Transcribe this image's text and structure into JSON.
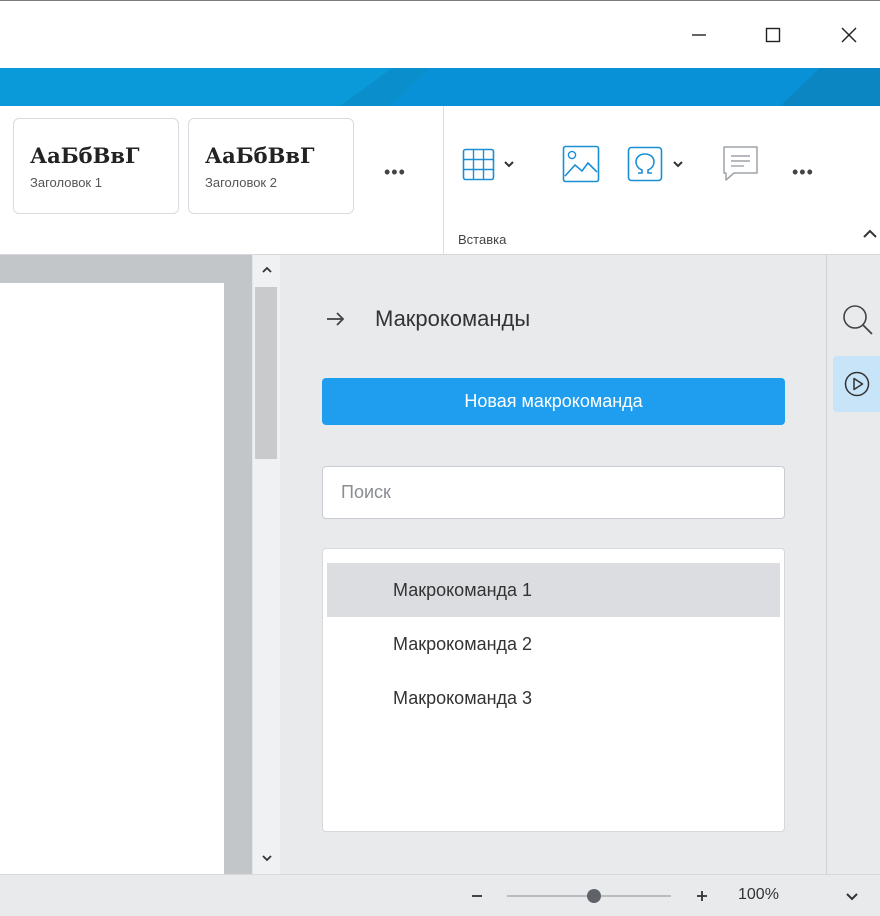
{
  "window": {
    "icons": {
      "minimize": "minimize-icon",
      "maximize": "maximize-icon",
      "close": "close-icon"
    }
  },
  "colors": {
    "accent": "#0a9ad9",
    "primary_button": "#1f9ef0",
    "panel_bg": "#e9eaec",
    "selected_item": "#dcdde0",
    "active_sidebar": "#c8e4f8"
  },
  "ribbon": {
    "styles": [
      {
        "sample": "АаБбВвГ",
        "caption": "Заголовок 1"
      },
      {
        "sample": "АаБбВвГ",
        "caption": "Заголовок 2"
      }
    ],
    "styles_more": "•••",
    "insert_group": {
      "label": "Вставка",
      "more": "•••",
      "icons": [
        "table-icon",
        "image-icon",
        "special-character-icon",
        "comment-icon"
      ]
    }
  },
  "panel": {
    "title": "Макрокоманды",
    "new_button": "Новая макрокоманда",
    "search_placeholder": "Поиск",
    "search_value": "",
    "items": [
      {
        "label": "Макрокоманда 1",
        "selected": true
      },
      {
        "label": "Макрокоманда 2",
        "selected": false
      },
      {
        "label": "Макрокоманда 3",
        "selected": false
      }
    ]
  },
  "sidebar": {
    "icons": [
      "search-icon",
      "play-circle-icon"
    ],
    "active": "play-circle-icon"
  },
  "status": {
    "zoom_label": "100%",
    "zoom_fraction": 0.53
  }
}
